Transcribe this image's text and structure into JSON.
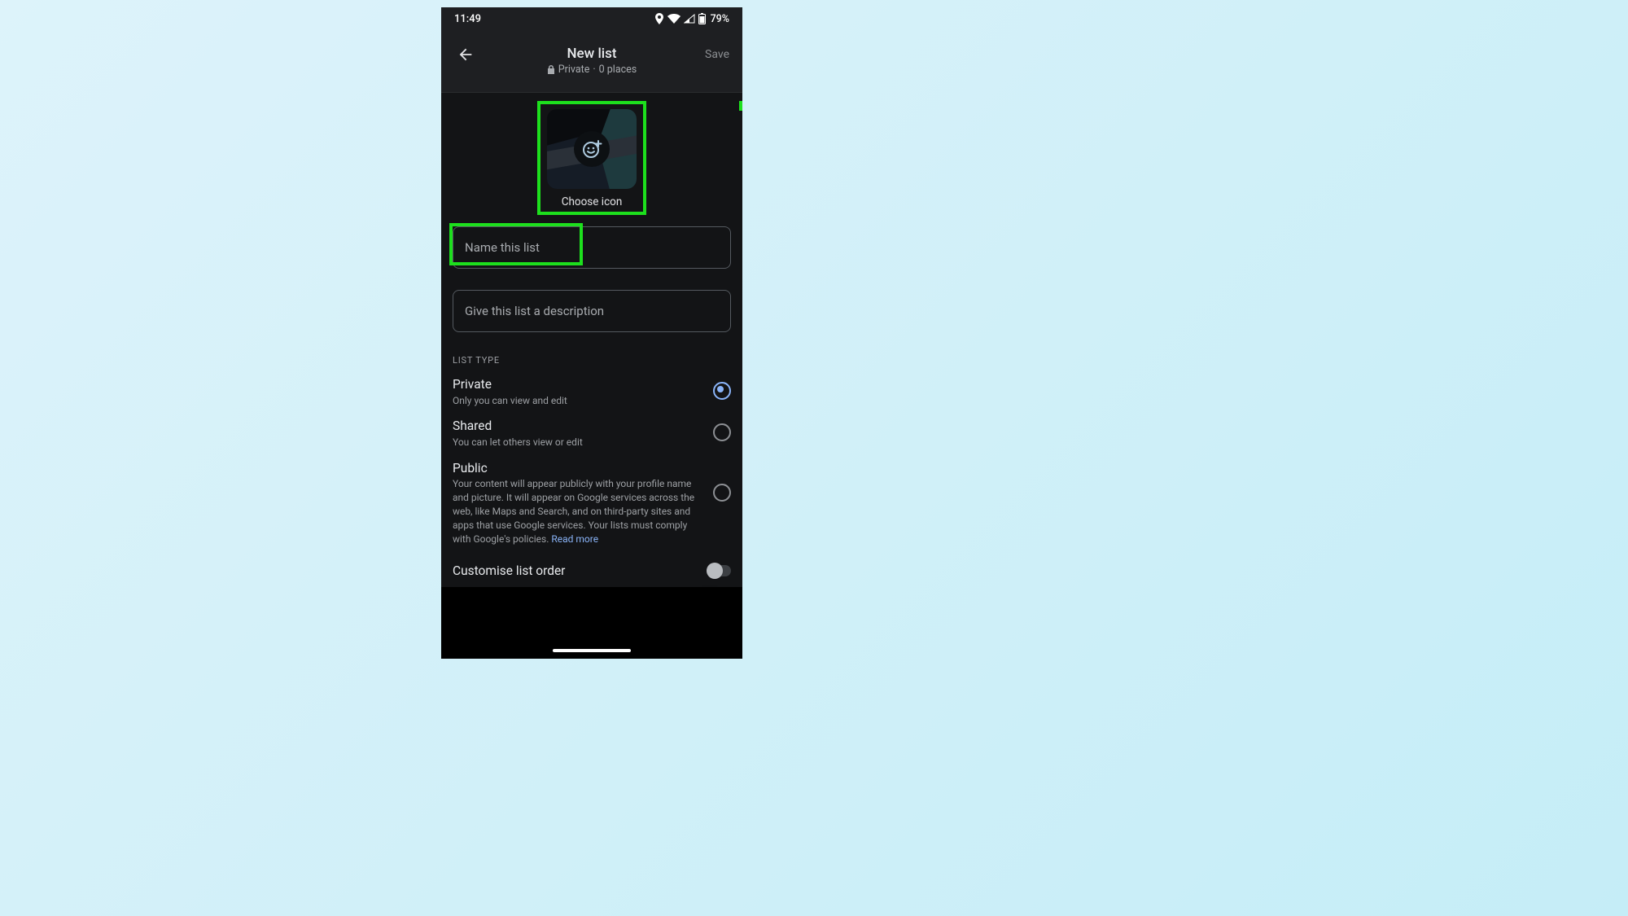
{
  "status": {
    "time": "11:49",
    "battery": "79%"
  },
  "appbar": {
    "title": "New list",
    "subtitle_privacy": "Private",
    "subtitle_places": "0 places",
    "save_label": "Save"
  },
  "choose_icon": {
    "label": "Choose icon"
  },
  "fields": {
    "name_placeholder": "Name this list",
    "desc_placeholder": "Give this list a description"
  },
  "section_label": "LIST TYPE",
  "options": {
    "private": {
      "title": "Private",
      "sub": "Only you can view and edit",
      "selected": true
    },
    "shared": {
      "title": "Shared",
      "sub": "You can let others view or edit",
      "selected": false
    },
    "public": {
      "title": "Public",
      "sub": "Your content will appear publicly with your profile name and picture. It will appear on Google services across the web, like Maps and Search, and on third-party sites and apps that use Google services. Your lists must comply with Google's policies. ",
      "read_more": "Read more",
      "selected": false
    }
  },
  "customise": {
    "label": "Customise list order",
    "enabled": false
  }
}
